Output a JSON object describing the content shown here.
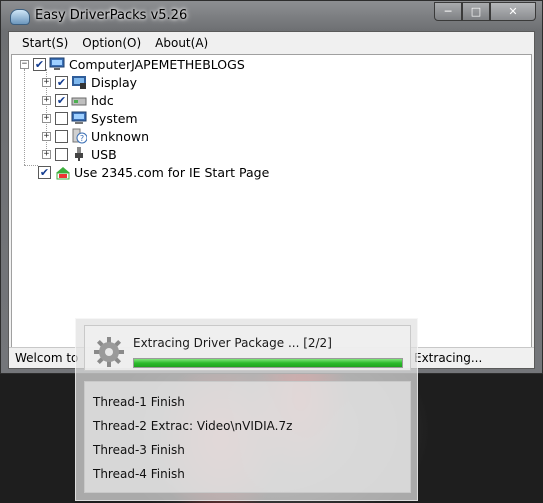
{
  "window": {
    "title": "Easy DriverPacks v5.26",
    "caption_min": "─",
    "caption_max": "□",
    "caption_close": "✕"
  },
  "menu": [
    "Start(S)",
    "Option(O)",
    "About(A)"
  ],
  "tree": {
    "root": {
      "label": "ComputerJAPEMETHEBLOGS",
      "checked": true,
      "icon": "computer-icon"
    },
    "children": [
      {
        "label": "Display",
        "checked": true,
        "icon": "display-icon"
      },
      {
        "label": "hdc",
        "checked": true,
        "icon": "disk-controller-icon"
      },
      {
        "label": "System",
        "checked": false,
        "icon": "system-icon"
      },
      {
        "label": "Unknown",
        "checked": false,
        "icon": "unknown-device-icon"
      },
      {
        "label": "USB",
        "checked": false,
        "icon": "usb-icon"
      }
    ],
    "extra": {
      "label": "Use 2345.com for IE Start Page",
      "checked": true,
      "icon": "2345-logo-icon"
    }
  },
  "status": {
    "left": "Welcom to",
    "right": "Extracing..."
  },
  "progress_dialog": {
    "title": "Extracing Driver Package ... [2/2]",
    "progress_fraction": 1.0,
    "threads": [
      "Thread-1 Finish",
      "Thread-2 Extrac:  Video\\nVIDIA.7z",
      "Thread-3 Finish",
      "Thread-4 Finish"
    ]
  },
  "colors": {
    "progress": "#2dbb2d",
    "check": "#123b8f"
  }
}
